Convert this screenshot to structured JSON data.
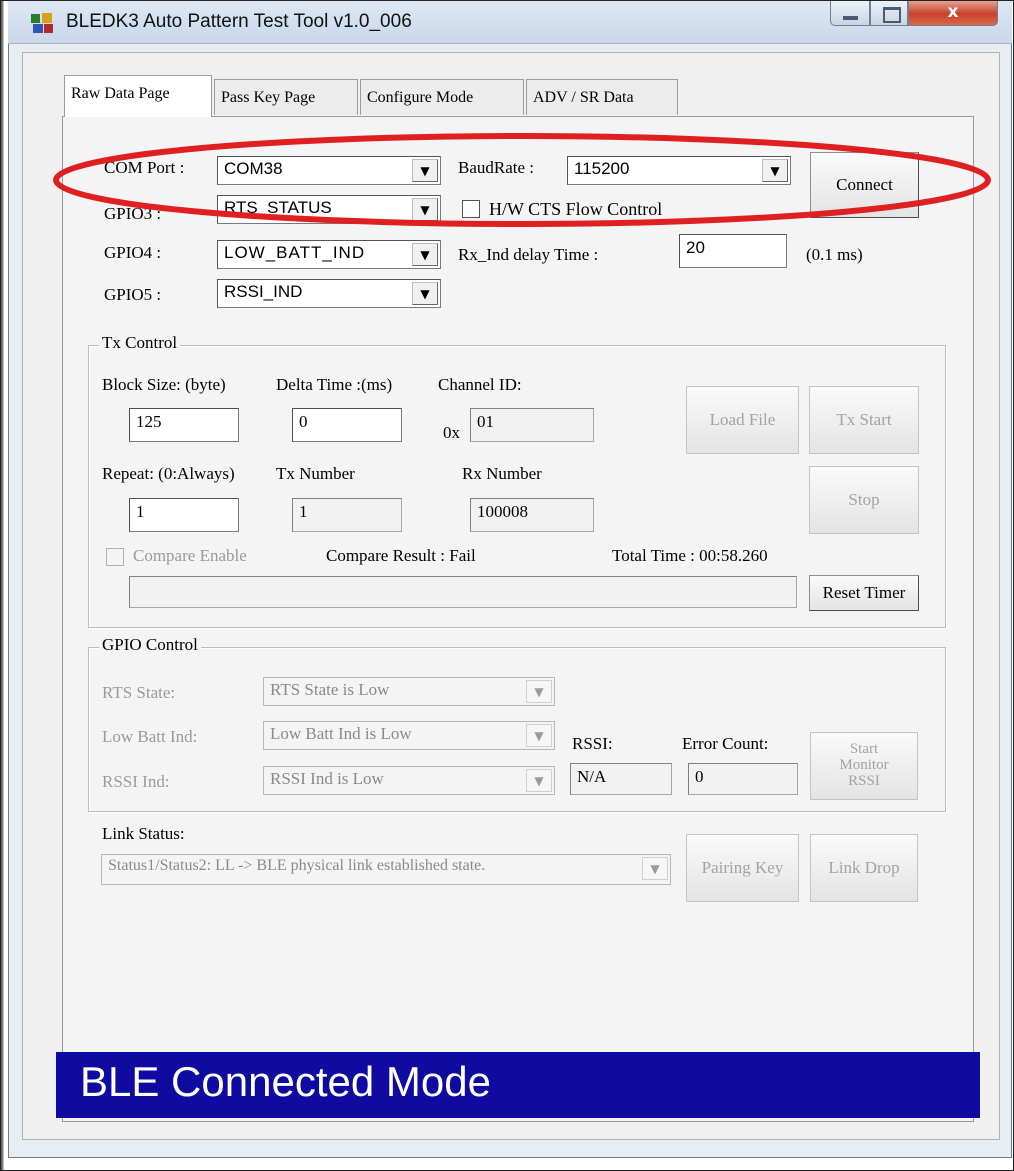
{
  "window": {
    "title": "BLEDK3 Auto Pattern Test Tool v1.0_006",
    "close_glyph": "x"
  },
  "tabs": [
    {
      "label": "Raw Data Page",
      "active": true
    },
    {
      "label": "Pass Key Page",
      "active": false
    },
    {
      "label": "Configure Mode",
      "active": false
    },
    {
      "label": "ADV / SR Data",
      "active": false
    }
  ],
  "connection": {
    "com_port_label": "COM Port :",
    "com_port_value": "COM38",
    "baud_rate_label": "BaudRate :",
    "baud_rate_value": "115200",
    "connect_label": "Connect",
    "gpio3_label": "GPIO3 :",
    "gpio3_value": "RTS_STATUS",
    "flow_control_label": "H/W CTS Flow Control",
    "gpio4_label": "GPIO4 :",
    "gpio4_value": "LOW_BATT_IND",
    "rx_ind_delay_label": "Rx_Ind delay Time :",
    "rx_ind_delay_value": "20",
    "rx_ind_delay_unit": "(0.1 ms)",
    "gpio5_label": "GPIO5 :",
    "gpio5_value": "RSSI_IND"
  },
  "tx_control": {
    "group_title": "Tx Control",
    "block_size_label": "Block Size: (byte)",
    "block_size_value": "125",
    "delta_time_label": "Delta Time :(ms)",
    "delta_time_value": "0",
    "channel_id_label": "Channel ID:",
    "channel_id_prefix": "0x",
    "channel_id_value": "01",
    "load_file_label": "Load File",
    "tx_start_label": "Tx Start",
    "repeat_label": "Repeat: (0:Always)",
    "repeat_value": "1",
    "tx_number_label": "Tx Number",
    "tx_number_value": "1",
    "rx_number_label": "Rx Number",
    "rx_number_value": "100008",
    "stop_label": "Stop",
    "compare_enable_label": "Compare Enable",
    "compare_result_text": "Compare Result : Fail",
    "total_time_text": "Total Time : 00:58.260",
    "progress_value": "",
    "reset_timer_label": "Reset Timer"
  },
  "gpio_control": {
    "group_title": "GPIO Control",
    "rts_state_label": "RTS State:",
    "rts_state_value": "RTS State is Low",
    "low_batt_label": "Low Batt Ind:",
    "low_batt_value": "Low Batt Ind is Low",
    "rssi_ind_label": "RSSI Ind:",
    "rssi_ind_value": "RSSI Ind is Low",
    "rssi_label": "RSSI:",
    "rssi_value": "N/A",
    "error_count_label": "Error Count:",
    "error_count_value": "0",
    "start_monitor_line1": "Start",
    "start_monitor_line2": "Monitor",
    "start_monitor_line3": "RSSI"
  },
  "link": {
    "status_label": "Link Status:",
    "status_value": "Status1/Status2: LL -> BLE physical link established state.",
    "pairing_key_label": "Pairing Key",
    "link_drop_label": "Link Drop"
  },
  "status_bar": {
    "text": "BLE Connected Mode"
  },
  "colors": {
    "status_bar_bg": "#0f0aa0",
    "highlight_ellipse": "#e02020",
    "close_button": "#c7432a"
  }
}
